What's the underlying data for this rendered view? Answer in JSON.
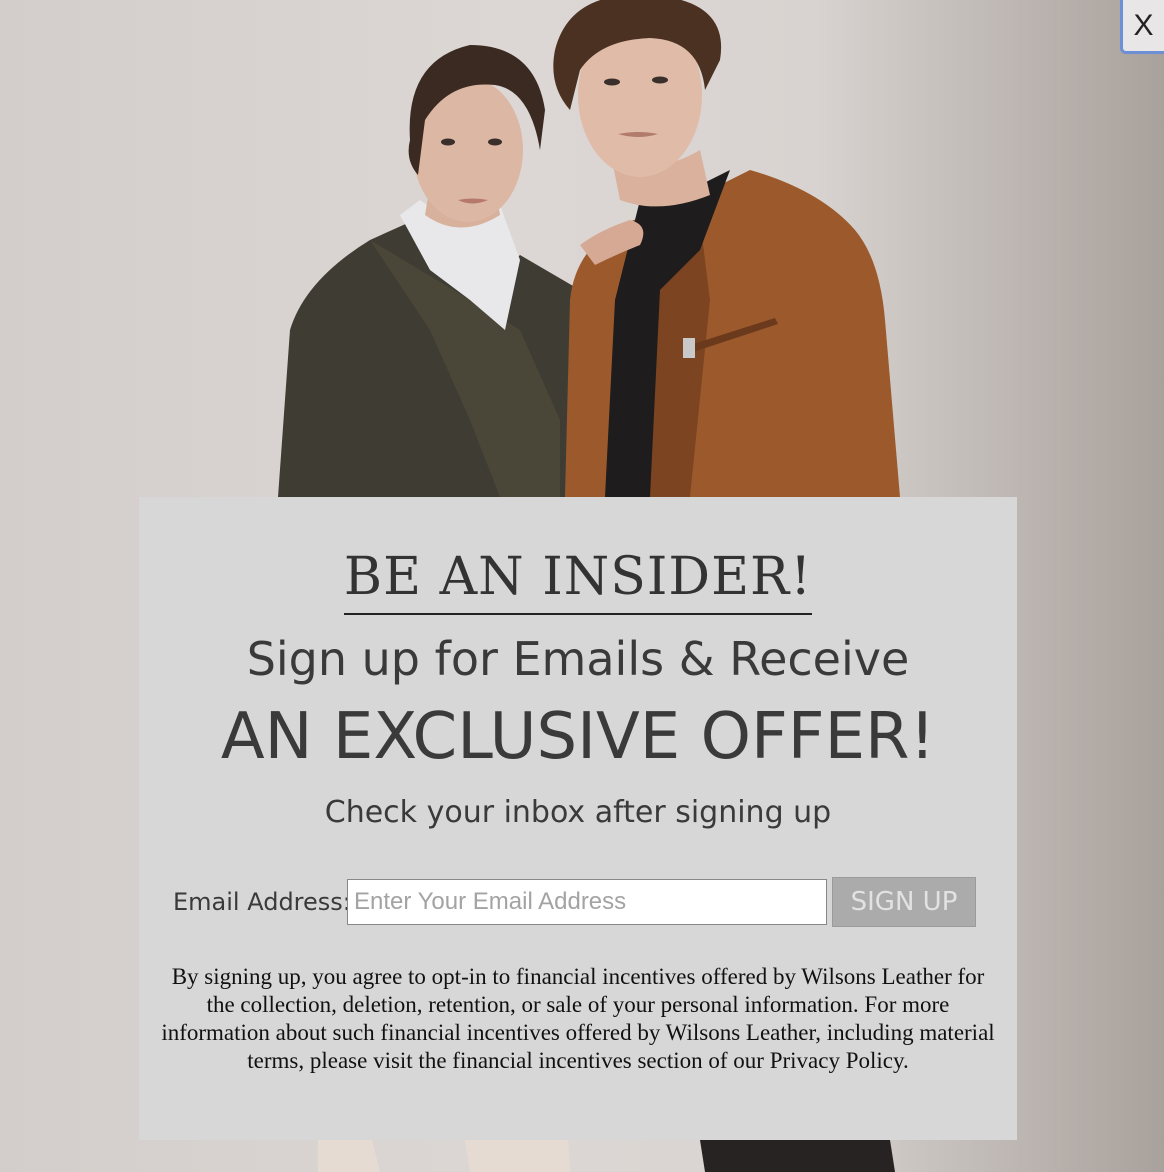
{
  "close_button": {
    "label": "X"
  },
  "popup": {
    "heading": "BE AN INSIDER!",
    "subtitle": "Sign up for Emails & Receive",
    "offer": "AN EXCLUSIVE OFFER!",
    "inbox_note": "Check your inbox after signing up",
    "email_label": "Email Address:",
    "email_placeholder": "Enter Your Email Address",
    "email_value": "",
    "signup_label": "SIGN UP",
    "legal": "By signing up, you agree to opt-in to financial incentives offered by Wilsons Leather for the collection, deletion, retention, or sale of your personal information. For more information about such financial incentives offered by Wilsons Leather, including material terms, please visit the financial incentives section of our Privacy Policy."
  },
  "colors": {
    "modal_background": "#d7d7d7",
    "signup_button": "#ababab",
    "close_border": "#6d8fd6"
  }
}
